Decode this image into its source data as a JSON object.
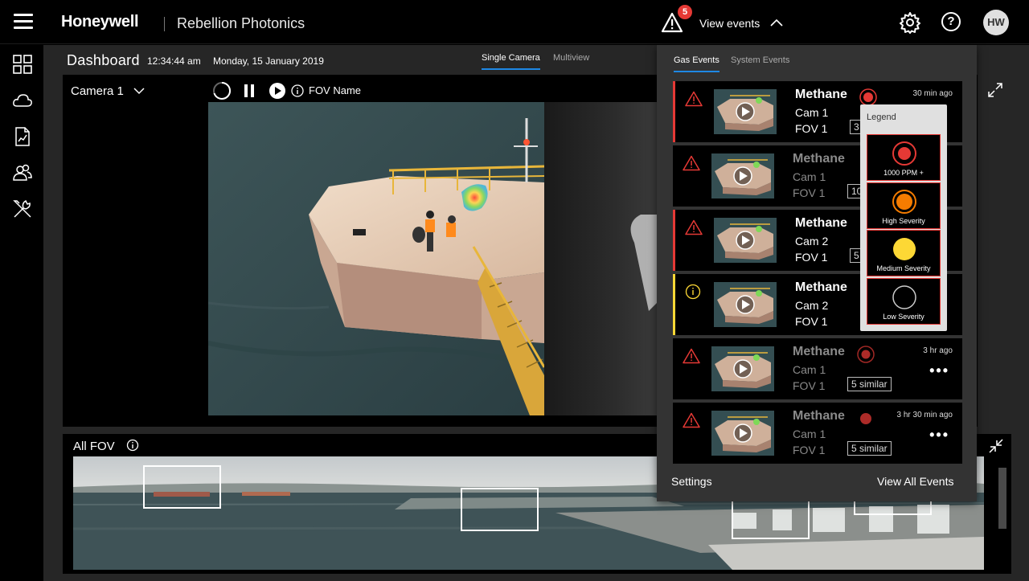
{
  "header": {
    "brand": "Honeywell",
    "product": "Rebellion Photonics",
    "alert_count": "5",
    "view_events_label": "View events",
    "avatar_initials": "HW",
    "help_glyph": "?"
  },
  "sidenav": {
    "items": [
      {
        "icon": "grid-icon"
      },
      {
        "icon": "cloud-icon"
      },
      {
        "icon": "report-icon"
      },
      {
        "icon": "users-icon"
      },
      {
        "icon": "tools-icon"
      }
    ]
  },
  "dashboard": {
    "title": "Dashboard",
    "time": "12:34:44 am",
    "date": "Monday, 15 January 2019",
    "tabs": [
      "Single Camera",
      "Multiview"
    ],
    "active_tab": "Single Camera"
  },
  "camera": {
    "selected": "Camera 1",
    "fov_name": "FOV Name"
  },
  "allfov": {
    "label": "All FOV"
  },
  "events_panel": {
    "tabs": [
      "Gas Events",
      "System Events"
    ],
    "active_tab": "Gas Events",
    "events": [
      {
        "gas": "Methane",
        "camera": "Cam 1",
        "fov": "FOV 1",
        "time_ago": "30 min ago",
        "similar": "3",
        "severity": "critical",
        "new": true
      },
      {
        "gas": "Methane",
        "camera": "Cam 1",
        "fov": "FOV 1",
        "time_ago": "",
        "similar": "10",
        "severity": "critical",
        "new": false
      },
      {
        "gas": "Methane",
        "camera": "Cam 2",
        "fov": "FOV 1",
        "time_ago": "",
        "similar": "5",
        "severity": "critical",
        "new": true
      },
      {
        "gas": "Methane",
        "camera": "Cam 2",
        "fov": "FOV 1",
        "time_ago": "",
        "similar": "",
        "severity": "medium",
        "new": true
      },
      {
        "gas": "Methane",
        "camera": "Cam 1",
        "fov": "FOV 1",
        "time_ago": "3 hr ago",
        "similar": "5 similar",
        "severity": "critical",
        "new": false
      },
      {
        "gas": "Methane",
        "camera": "Cam 1",
        "fov": "FOV 1",
        "time_ago": "3 hr 30 min ago",
        "similar": "5 similar",
        "severity": "critical",
        "new": false
      }
    ],
    "legend": {
      "title": "Legend",
      "items": [
        {
          "label": "1000 PPM +",
          "color": "#e53935"
        },
        {
          "label": "High Severity",
          "color": "#f57c00"
        },
        {
          "label": "Medium Severity",
          "color": "#fdd835"
        },
        {
          "label": "Low Severity",
          "color": "#000000"
        }
      ]
    },
    "settings_label": "Settings",
    "view_all_label": "View All Events"
  },
  "colors": {
    "critical": "#e53935",
    "medium": "#fdd835",
    "accent": "#1e88e5"
  }
}
